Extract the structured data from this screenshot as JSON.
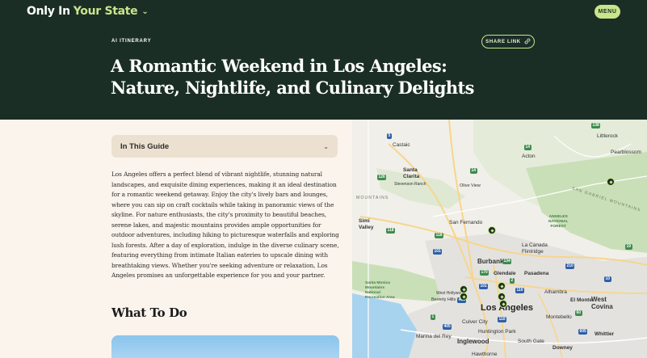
{
  "header": {
    "logo_part1": "Only In",
    "logo_part2": "Your State",
    "menu_label": "MENU",
    "eyebrow": "AI ITINERARY",
    "share_label": "SHARE LINK",
    "title": "A Romantic Weekend in Los Angeles: Nature, Nightlife, and Culinary Delights"
  },
  "guide": {
    "label": "In This Guide"
  },
  "intro": "Los Angeles offers a perfect blend of vibrant nightlife, stunning natural landscapes, and exquisite dining experiences, making it an ideal destination for a romantic weekend getaway. Enjoy the city's lively bars and lounges, where you can sip on craft cocktails while taking in panoramic views of the skyline. For nature enthusiasts, the city's proximity to beautiful beaches, serene lakes, and majestic mountains provides ample opportunities for outdoor adventures, including hiking to picturesque waterfalls and exploring lush forests. After a day of exploration, indulge in the diverse culinary scene, featuring everything from intimate Italian eateries to upscale dining with breathtaking views. Whether you're seeking adventure or relaxation, Los Angeles promises an unforgettable experience for you and your partner.",
  "section": {
    "title": "What To Do"
  },
  "map": {
    "labels": {
      "castaic": "Castaic",
      "santa_clarita": "Santa\nClarita",
      "stevenson_ranch": "Stevenson Ranch",
      "acton": "Acton",
      "littlerock": "Littlerock",
      "pearblossom": "Pearblossom",
      "olive_view": "Olive View",
      "simi_valley": "Simi\nValley",
      "san_fernando": "San Fernando",
      "san_gabriel_mtn": "SAN GABRIEL MOUNTAINS",
      "angeles_forest": "ANGELES\nNATIONAL\nFOREST",
      "mountains": "MOUNTAINS",
      "la_canada": "La Canada\nFlintridge",
      "burbank": "Burbank",
      "glendale": "Glendale",
      "pasadena": "Pasadena",
      "santa_monica_mtns": "Santa Monica\nMountains\nNational\nRecreation Area",
      "west_hollywood": "West Hollywood",
      "beverly_hills": "Beverly Hills",
      "los_angeles": "Los Angeles",
      "alhambra": "Alhambra",
      "west_covina": "West\nCovina",
      "el_monte": "El Monte",
      "culver_city": "Culver City",
      "marina_del_rey": "Marina del Rey",
      "huntington_park": "Huntington Park",
      "montebello": "Montebello",
      "inglewood": "Inglewood",
      "south_gate": "South Gate",
      "downey": "Downey",
      "hawthorne": "Hawthorne",
      "whittier": "Whittier"
    },
    "shields": [
      "5",
      "14",
      "14",
      "126",
      "118",
      "118",
      "101",
      "101",
      "405",
      "405",
      "2",
      "110",
      "110",
      "60",
      "10",
      "605",
      "210",
      "134",
      "138",
      "1",
      "19",
      "170"
    ],
    "colors": {
      "land": "#f1efe9",
      "park": "#c9dfb8",
      "urban": "#e3e2df",
      "water": "#a8d3ef",
      "road": "#ffffff",
      "highway": "#f7d58c",
      "marker_fill": "#1b2e26",
      "marker_ring": "#c9e58a"
    }
  }
}
